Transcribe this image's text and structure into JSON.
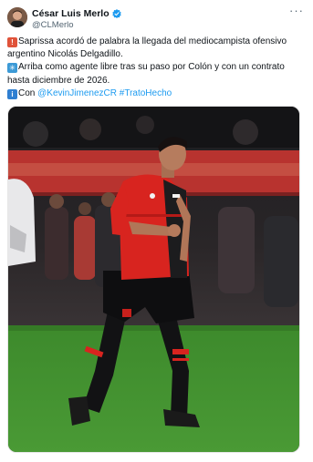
{
  "author": {
    "display_name": "César Luis Merlo",
    "handle": "@CLMerlo"
  },
  "more_menu_label": "···",
  "tweet": {
    "line1": "Saprissa acordó de palabra la llegada del mediocampista ofensivo argentino Nicolás Delgadillo.",
    "line2": "Arriba como agente libre tras su paso por Colón y con un contrato hasta diciembre de 2026.",
    "line3_prefix": "Con ",
    "mention": "@KevinJimenezCR",
    "hashtag": "#TratoHecho"
  },
  "emoji": {
    "line1": "siren-emoji",
    "line2": "star-emoji",
    "line3": "info-emoji"
  },
  "colors": {
    "link": "#1d9bf0",
    "verified": "#1d9bf0",
    "jersey_red": "#d8241f",
    "pitch_green": "#3f8a2c"
  }
}
